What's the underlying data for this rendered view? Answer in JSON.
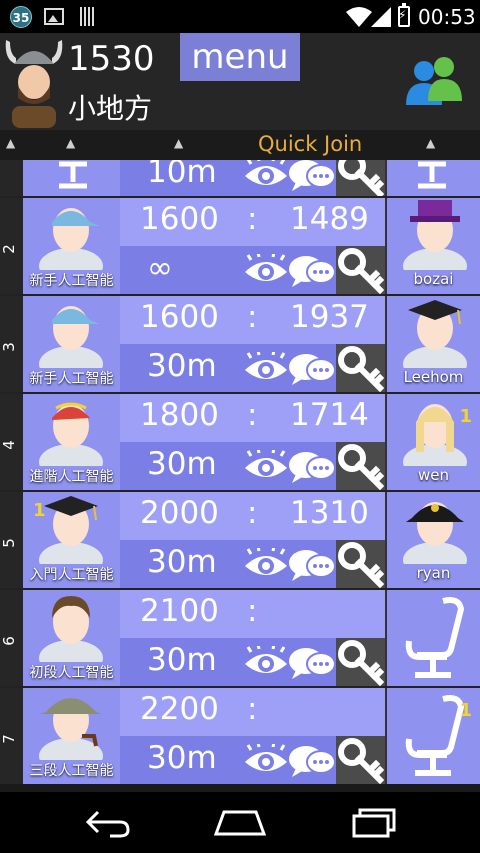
{
  "statusbar": {
    "notif_count": "35",
    "time": "00:53"
  },
  "header": {
    "score": "1530",
    "nickname": "小地方",
    "menu_label": "menu"
  },
  "colbar": {
    "quick_join": "Quick Join"
  },
  "partial_row": {
    "time": "10m"
  },
  "rows": [
    {
      "index": "2",
      "player1": "新手人工智能",
      "score1": "1600",
      "colon": ":",
      "score2": "1489",
      "time": "∞",
      "player2": "bozai"
    },
    {
      "index": "3",
      "player1": "新手人工智能",
      "score1": "1600",
      "colon": ":",
      "score2": "1937",
      "time": "30m",
      "player2": "Leehom"
    },
    {
      "index": "4",
      "player1": "進階人工智能",
      "score1": "1800",
      "colon": ":",
      "score2": "1714",
      "time": "30m",
      "player2": "wen",
      "badge2": "1"
    },
    {
      "index": "5",
      "player1": "入門人工智能",
      "score1": "2000",
      "colon": ":",
      "score2": "1310",
      "time": "30m",
      "player2": "ryan",
      "badge1": "1"
    },
    {
      "index": "6",
      "player1": "初段人工智能",
      "score1": "2100",
      "colon": ":",
      "score2": "",
      "time": "30m",
      "player2": ""
    },
    {
      "index": "7",
      "player1": "三段人工智能",
      "score1": "2200",
      "colon": ":",
      "score2": "",
      "time": "30m",
      "player2": "",
      "badge2": "1"
    }
  ],
  "icons": {
    "eye": "eye-icon",
    "chat": "chat-icon",
    "key": "key-icon",
    "chair": "chair-icon",
    "back": "back-icon",
    "home": "home-icon",
    "recent": "recent-apps-icon"
  },
  "colors": {
    "row_light": "#9da0f6",
    "row_dark": "#7b7fe5",
    "menu": "#7b7fd6",
    "quick_join": "#e7ac3b"
  }
}
